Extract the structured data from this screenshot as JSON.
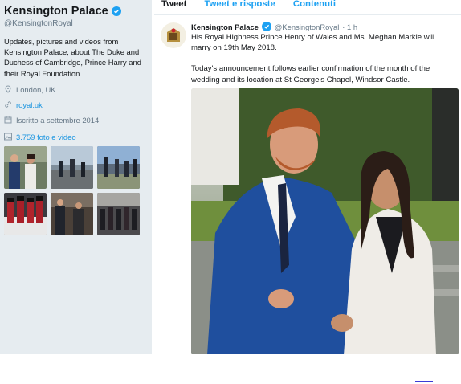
{
  "profile": {
    "name": "Kensington Palace",
    "handle": "@KensingtonRoyal",
    "bio": "Updates, pictures and videos from Kensington Palace, about The Duke and Duchess of Cambridge, Prince Harry and their Royal Foundation.",
    "location": "London, UK",
    "website": "royal.uk",
    "joined": "Iscritto a settembre 2014",
    "media_count_label": "3.759 foto e video",
    "verified_color": "#1da1f2",
    "thumbnail_icons": [
      "photo-1",
      "photo-2",
      "photo-3",
      "photo-4",
      "photo-5",
      "photo-6"
    ]
  },
  "tabs": [
    {
      "label": "Tweet",
      "active": true
    },
    {
      "label": "Tweet e risposte",
      "active": false
    },
    {
      "label": "Contenuti",
      "active": false
    }
  ],
  "tweet": {
    "author": "Kensington Palace",
    "handle": "@KensingtonRoyal",
    "time": "· 1 h",
    "paragraph1": "His Royal Highness Prince Henry of Wales and Ms. Meghan Markle will marry on 19th May 2018.",
    "paragraph2": "Today's announcement follows earlier confirmation of the month of the wedding and its location at St George's Chapel, Windsor Castle."
  },
  "colors": {
    "sidebar_bg": "#e6ecf0",
    "link": "#1b95e0",
    "accent": "#1da1f2"
  }
}
